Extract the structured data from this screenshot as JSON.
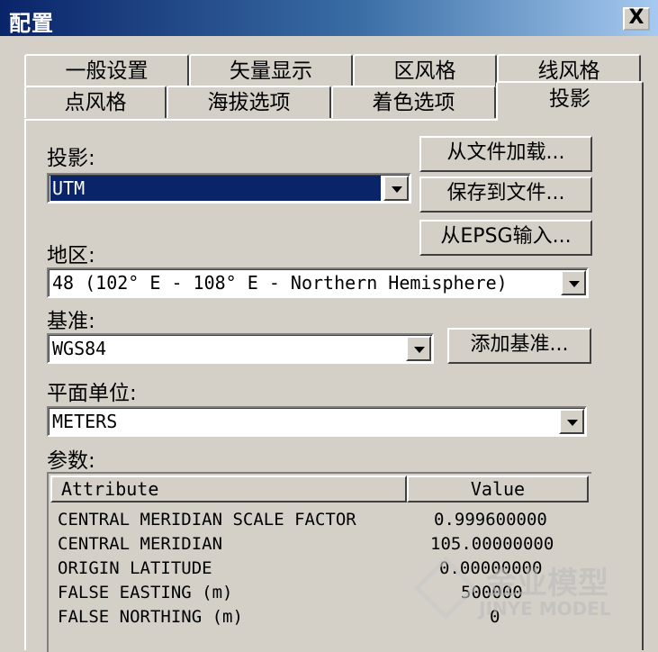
{
  "window": {
    "title": "配置",
    "close_label": "X"
  },
  "tabs": {
    "row1": [
      "一般设置",
      "矢量显示",
      "区风格",
      "线风格"
    ],
    "row2": [
      "点风格",
      "海拔选项",
      "着色选项",
      "投影"
    ],
    "active": "投影"
  },
  "projection": {
    "label": "投影:",
    "value": "UTM"
  },
  "zone": {
    "label": "地区:",
    "value": "48 (102° E - 108° E - Northern Hemisphere)"
  },
  "datum": {
    "label": "基准:",
    "value": "WGS84"
  },
  "planar_units": {
    "label": "平面单位:",
    "value": "METERS"
  },
  "buttons": {
    "load_file": "从文件加载...",
    "save_file": "保存到文件...",
    "import_epsg": "从EPSG输入...",
    "add_datum": "添加基准..."
  },
  "params": {
    "label": "参数:",
    "columns": [
      "Attribute",
      "Value"
    ],
    "rows": [
      {
        "attr": "CENTRAL MERIDIAN SCALE FACTOR",
        "value": "0.999600000"
      },
      {
        "attr": "CENTRAL MERIDIAN",
        "value": "105.00000000"
      },
      {
        "attr": "ORIGIN LATITUDE",
        "value": "0.00000000"
      },
      {
        "attr": "FALSE EASTING (m)",
        "value": "500000"
      },
      {
        "attr": "FALSE NORTHING (m)",
        "value": "0"
      }
    ]
  },
  "watermark": {
    "line1": "金业模型",
    "line2": "JINYE MODEL"
  }
}
